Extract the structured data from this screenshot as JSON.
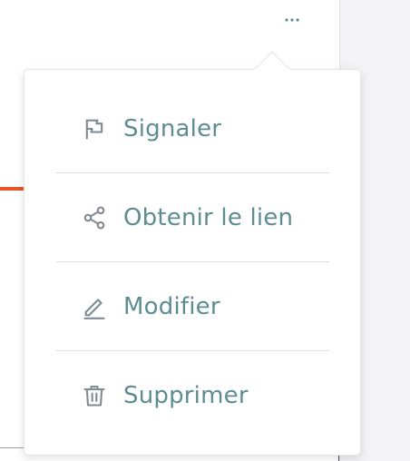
{
  "menu": {
    "items": [
      {
        "label": "Signaler",
        "icon": "flag-icon"
      },
      {
        "label": "Obtenir le lien",
        "icon": "share-icon"
      },
      {
        "label": "Modifier",
        "icon": "edit-icon"
      },
      {
        "label": "Supprimer",
        "icon": "trash-icon"
      }
    ]
  },
  "colors": {
    "accent": "#e4572e",
    "label_text": "#5d8d93",
    "icon": "#7f8a93",
    "divider": "#dcdce2"
  }
}
